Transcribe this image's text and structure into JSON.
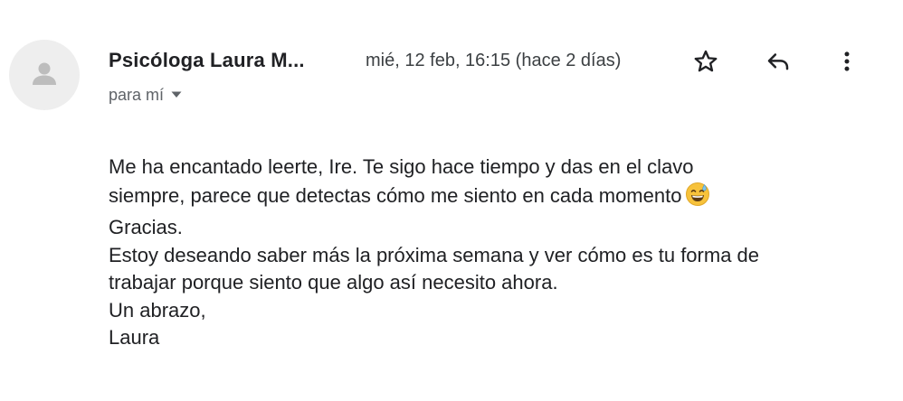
{
  "email": {
    "sender_name": "Psicóloga Laura M...",
    "date": "mié, 12 feb, 16:15 (hace 2 días)",
    "recipient": "para mí",
    "body_lines": [
      "Me ha encantado leerte, Ire. Te sigo hace tiempo y das en el clavo",
      "siempre, parece que detectas cómo me siento en cada momento",
      "Gracias.",
      "Estoy deseando saber más la próxima semana y ver cómo es tu forma de",
      "trabajar porque siento que algo así necesito ahora.",
      "Un abrazo,",
      "Laura"
    ]
  },
  "icons": {
    "avatar": "person-icon",
    "star": "star-icon",
    "reply": "reply-icon",
    "more": "more-vert-icon",
    "recipient_dropdown": "caret-down-icon",
    "emoji": "grinning-face-with-sweat-emoji"
  },
  "colors": {
    "text_primary": "#202124",
    "text_secondary": "#5f6368",
    "avatar_bg": "#eeeeee",
    "avatar_fg": "#bdbdbd",
    "emoji_yellow": "#f7c23b"
  }
}
